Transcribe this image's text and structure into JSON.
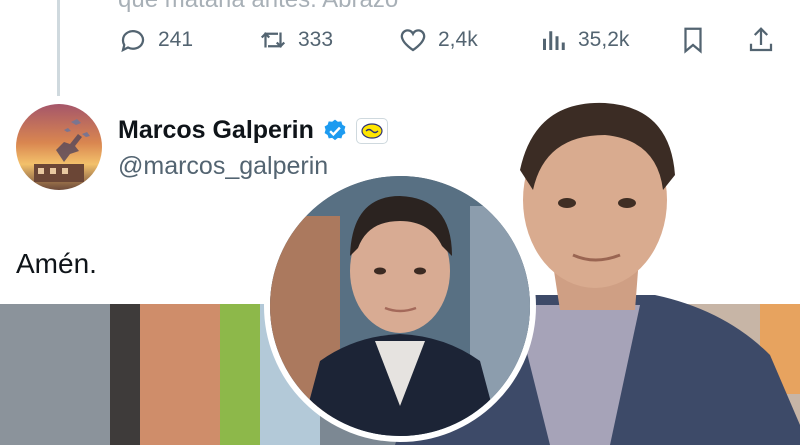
{
  "previous_tweet": {
    "text_fragment": "que mataria antes. Abrazo",
    "actions": {
      "replies": "241",
      "reposts": "333",
      "likes": "2,4k",
      "views": "35,2k"
    }
  },
  "tweet": {
    "display_name": "Marcos Galperin",
    "handle": "@marcos_galperin",
    "text": "Amén."
  },
  "colors": {
    "text_primary": "#0f1419",
    "text_secondary": "#536471",
    "verified_blue": "#1d9bf0",
    "divider": "#cfd9de"
  },
  "icons": [
    "reply-icon",
    "repost-icon",
    "like-icon",
    "views-icon",
    "bookmark-icon",
    "share-icon",
    "verified-badge-icon",
    "affiliation-badge-icon"
  ]
}
